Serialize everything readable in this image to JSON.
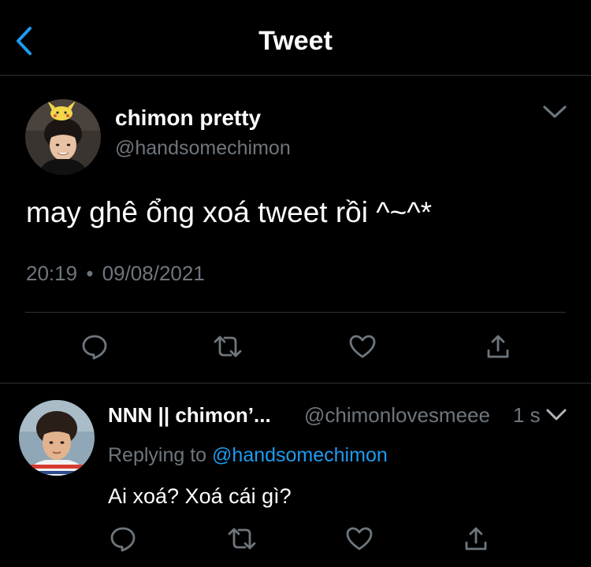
{
  "colors": {
    "background": "#000000",
    "accent": "#1d9bf0",
    "secondary_text": "#6e767d",
    "divider": "#2f3336"
  },
  "header": {
    "title": "Tweet",
    "back_icon": "chevron-left-icon"
  },
  "tweet": {
    "author_name": "chimon pretty",
    "author_handle": "@handsomechimon",
    "text": "may ghê ổng xoá tweet rồi ^~^*",
    "time": "20:19",
    "separator": "•",
    "date": "09/08/2021",
    "actions": [
      "reply-icon",
      "retweet-icon",
      "like-icon",
      "share-icon"
    ]
  },
  "reply": {
    "author_name": "NNN || chimon’...",
    "author_handle": "@chimonlovesmeee",
    "age": "1 s",
    "replying_label": "Replying to",
    "replying_to": "@handsomechimon",
    "text": "Ai xoá? Xoá cái gì?",
    "actions": [
      "reply-icon",
      "retweet-icon",
      "like-icon",
      "share-icon"
    ]
  }
}
